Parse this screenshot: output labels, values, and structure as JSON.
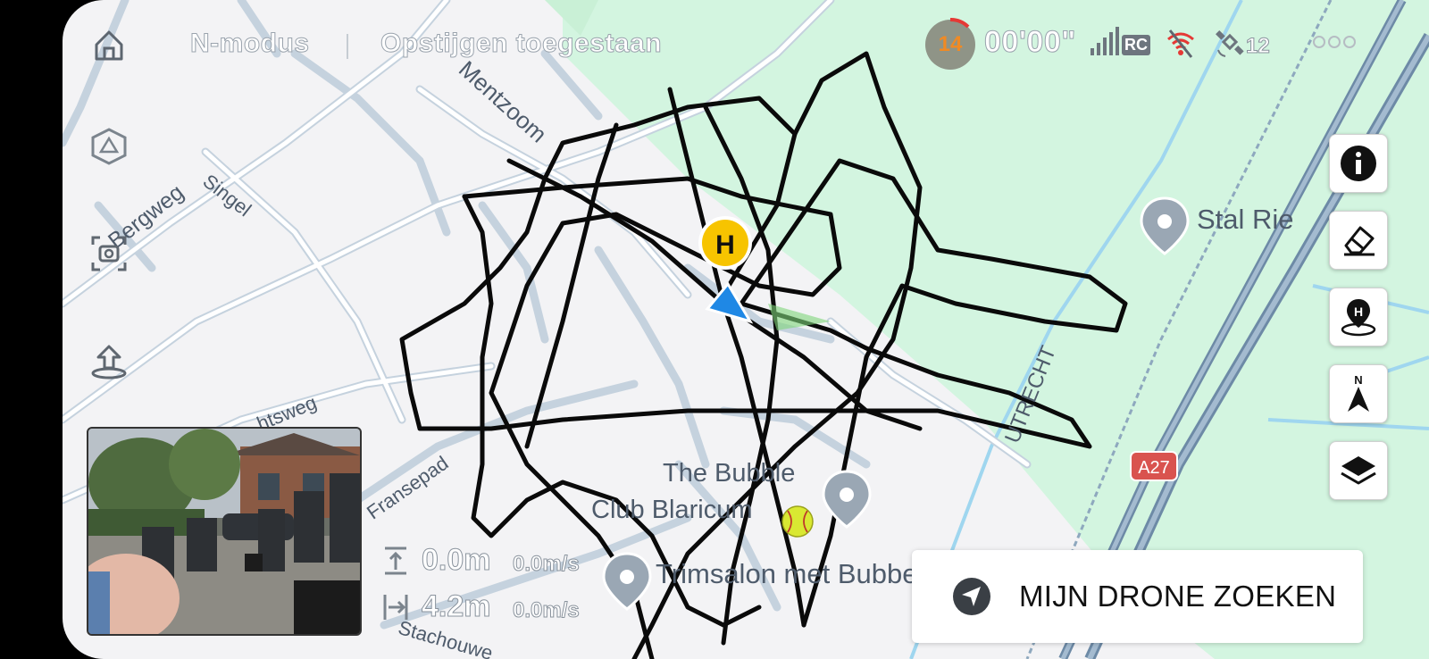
{
  "status_bar": {
    "flight_mode": "N-modus",
    "takeoff_status": "Opstijgen toegestaan",
    "battery_percent": "14",
    "flight_time": "00'00\"",
    "rc_label": "RC",
    "satellite_count": "12"
  },
  "map": {
    "street_labels": {
      "mentzoom": "Mentzoom",
      "bergweg": "Bergweg",
      "singel": "Singel",
      "rechtsweg": "htsweg",
      "fransepad": "Fransepad",
      "stachouwer": "Stachouwe",
      "utrecht": "UTRECHT"
    },
    "road_sign": "A27",
    "home_marker": "H",
    "pois": {
      "stal_label": "Stal Rie",
      "bubble_line1": "The Bubble",
      "bubble_line2": "Club Blaricum",
      "trimsalon": "Trimsalon met Bubbel"
    },
    "colors": {
      "grass": "#d3f5e0",
      "base": "#f3f3f5",
      "road_outline": "#c5d2de",
      "flight_path": "#0a0a0a",
      "home_marker": "#f7c400",
      "drone_arrow": "#1f88e5",
      "water": "#9fd6ef",
      "highway": "#6d8aa6"
    }
  },
  "telemetry": {
    "altitude": "0.0m",
    "vertical_speed": "0.0m/s",
    "distance": "4.2m",
    "horizontal_speed": "0.0m/s"
  },
  "actions": {
    "find_drone": "MIJN DRONE ZOEKEN",
    "side_buttons": [
      "info-icon",
      "eraser-icon",
      "home-point-icon",
      "north-compass-icon",
      "layers-icon"
    ],
    "compass_letter": "N",
    "home_point_letter": "H"
  }
}
